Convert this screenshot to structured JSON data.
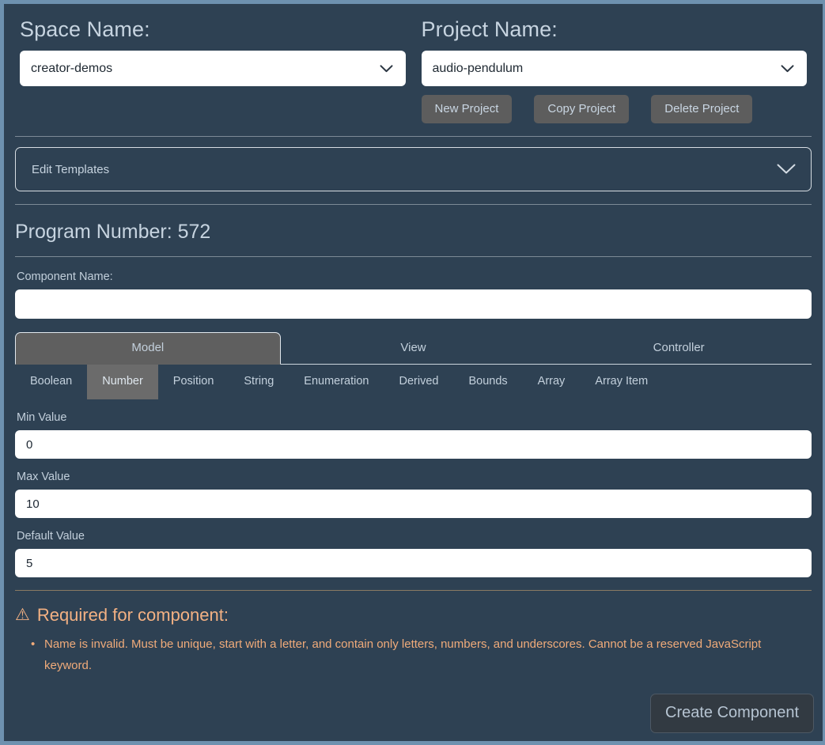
{
  "header": {
    "space": {
      "label": "Space Name:",
      "value": "creator-demos",
      "chevron_icon": "chevron-down-icon"
    },
    "project": {
      "label": "Project Name:",
      "value": "audio-pendulum",
      "chevron_icon": "chevron-down-icon"
    },
    "buttons": [
      {
        "label": "New Project"
      },
      {
        "label": "Copy Project"
      },
      {
        "label": "Delete Project"
      }
    ]
  },
  "accordion": {
    "label": "Edit Templates",
    "chevron_icon": "chevron-down-icon"
  },
  "program": {
    "title": "Program Number: 572"
  },
  "component": {
    "name_label": "Component Name:",
    "name_value": "",
    "name_placeholder": ""
  },
  "main_tabs": [
    {
      "label": "Model",
      "active": true
    },
    {
      "label": "View",
      "active": false
    },
    {
      "label": "Controller",
      "active": false
    }
  ],
  "sub_tabs": [
    {
      "label": "Boolean",
      "active": false
    },
    {
      "label": "Number",
      "active": true
    },
    {
      "label": "Position",
      "active": false
    },
    {
      "label": "String",
      "active": false
    },
    {
      "label": "Enumeration",
      "active": false
    },
    {
      "label": "Derived",
      "active": false
    },
    {
      "label": "Bounds",
      "active": false
    },
    {
      "label": "Array",
      "active": false
    },
    {
      "label": "Array Item",
      "active": false
    }
  ],
  "fields": {
    "min": {
      "label": "Min Value",
      "value": "0"
    },
    "max": {
      "label": "Max Value",
      "value": "10"
    },
    "default": {
      "label": "Default Value",
      "value": "5"
    }
  },
  "warning": {
    "icon": "warning-triangle-icon",
    "glyph": "⚠",
    "title": "Required for component:",
    "items": [
      "Name is invalid. Must be unique, start with a letter, and contain only letters, numbers, and underscores. Cannot be a reserved JavaScript keyword."
    ]
  },
  "create_button": {
    "label": "Create Component"
  },
  "colors": {
    "page_background": "#2e4153",
    "page_border": "#6e91af",
    "button_gray": "#5d5d5d",
    "active_tab_gray": "#5f5f5f",
    "warning_orange": "#f0ab7a",
    "input_white": "#ffffff",
    "text_light": "#c7d4e0"
  }
}
